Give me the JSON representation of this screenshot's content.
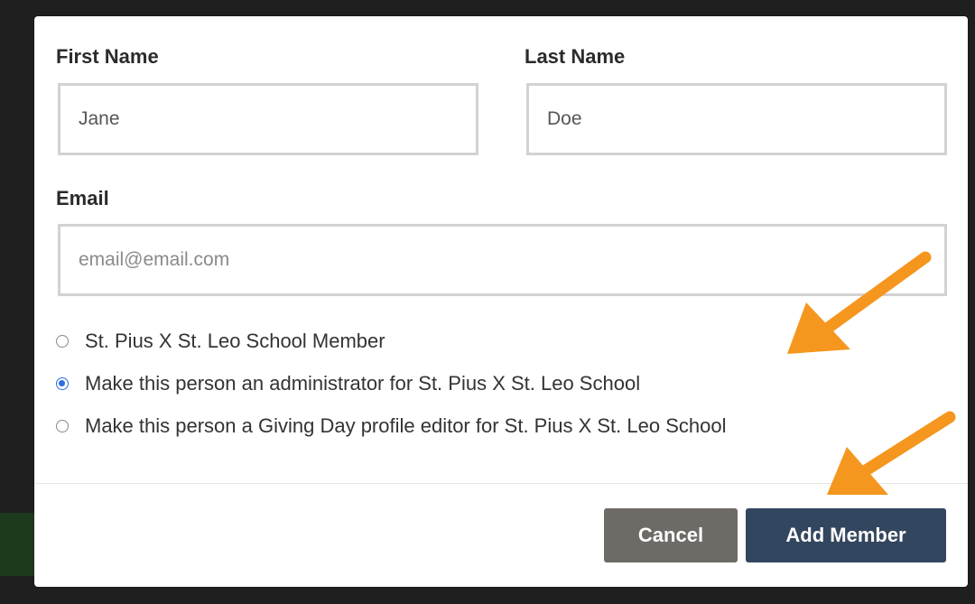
{
  "form": {
    "first_name_label": "First Name",
    "first_name_value": "Jane",
    "last_name_label": "Last Name",
    "last_name_value": "Doe",
    "email_label": "Email",
    "email_placeholder": "email@email.com"
  },
  "roles": [
    {
      "label": "St. Pius X St. Leo School Member",
      "checked": false
    },
    {
      "label": "Make this person an administrator for St. Pius X St. Leo School",
      "checked": true
    },
    {
      "label": "Make this person a Giving Day profile editor for St. Pius X St. Leo School",
      "checked": false
    }
  ],
  "actions": {
    "cancel_label": "Cancel",
    "add_label": "Add Member"
  },
  "colors": {
    "annotation_arrow": "#f5961e",
    "radio_accent": "#2f6fe0",
    "primary_button": "#33465f",
    "secondary_button": "#6e6b66"
  }
}
